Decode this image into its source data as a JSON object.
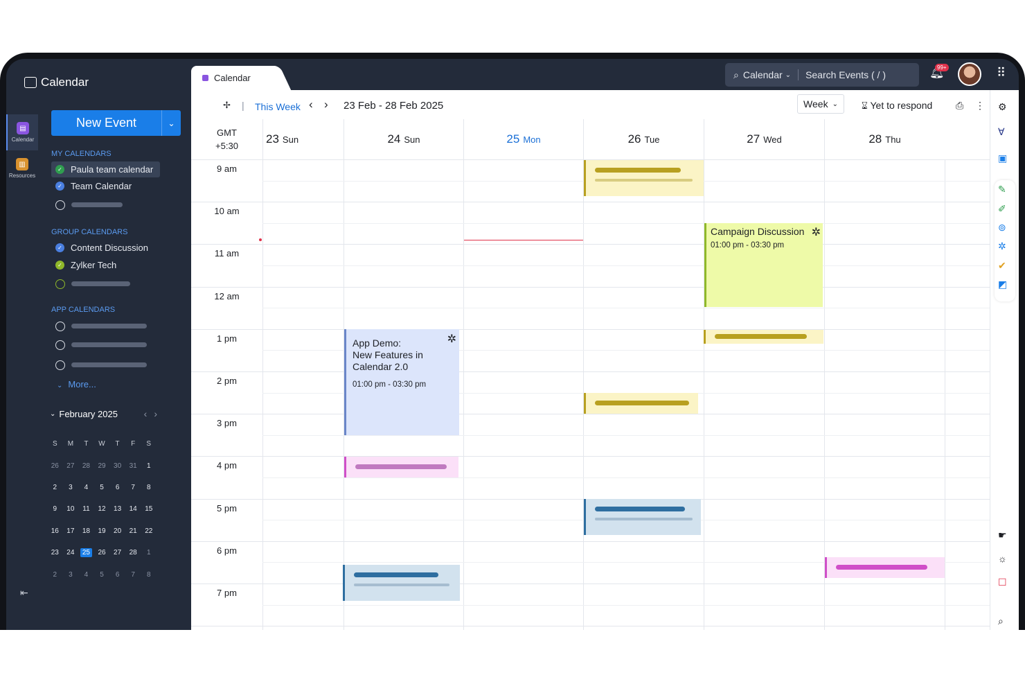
{
  "app": {
    "title": "Calendar",
    "tab_label": "Calendar"
  },
  "rail": [
    {
      "label": "Calendar",
      "color": "#8a55e0",
      "active": true
    },
    {
      "label": "Resources",
      "color": "#d9922e",
      "active": false
    }
  ],
  "sidebar": {
    "new_event_label": "New Event",
    "my_calendars_title": "MY CALENDARS",
    "my_calendars": [
      {
        "name": "Paula team calendar",
        "color": "#2f9e4f",
        "checked": true
      },
      {
        "name": "Team Calendar",
        "color": "#4a7fe0",
        "checked": true
      },
      {
        "name": "",
        "color": "#d8dce3",
        "checked": false
      }
    ],
    "group_calendars_title": "GROUP CALENDARS",
    "group_calendars": [
      {
        "name": "Content Discussion",
        "color": "#4a7fe0",
        "checked": true
      },
      {
        "name": "Zylker Tech",
        "color": "#8fb82a",
        "checked": true
      },
      {
        "name": "",
        "color": "#8fb82a",
        "checked": false
      }
    ],
    "app_calendars_title": "APP CALENDARS",
    "more_label": "More...",
    "mini_month": "February 2025",
    "mini_weekdays": [
      "S",
      "M",
      "T",
      "W",
      "T",
      "F",
      "S"
    ],
    "mini_weeks": [
      [
        "26",
        "27",
        "28",
        "29",
        "30",
        "31",
        "1"
      ],
      [
        "2",
        "3",
        "4",
        "5",
        "6",
        "7",
        "8"
      ],
      [
        "9",
        "10",
        "11",
        "12",
        "13",
        "14",
        "15"
      ],
      [
        "16",
        "17",
        "18",
        "19",
        "20",
        "21",
        "22"
      ],
      [
        "23",
        "24",
        "25",
        "26",
        "27",
        "28",
        "1"
      ],
      [
        "2",
        "3",
        "4",
        "5",
        "6",
        "7",
        "8"
      ]
    ]
  },
  "header": {
    "search_scope": "Calendar",
    "search_placeholder": "Search Events ( / )",
    "notif_badge": "99+"
  },
  "toolbar": {
    "this_week": "This Week",
    "date_range": "23 Feb - 28 Feb 2025",
    "view": "Week",
    "filter": "Yet to respond"
  },
  "grid": {
    "gmt_line1": "GMT",
    "gmt_line2": "+5:30",
    "days": [
      {
        "num": "23",
        "name": "Sun",
        "today": false
      },
      {
        "num": "24",
        "name": "Sun",
        "today": false
      },
      {
        "num": "25",
        "name": "Mon",
        "today": true
      },
      {
        "num": "26",
        "name": "Tue",
        "today": false
      },
      {
        "num": "27",
        "name": "Wed",
        "today": false
      },
      {
        "num": "28",
        "name": "Thu",
        "today": false
      }
    ],
    "hours": [
      "9 am",
      "10 am",
      "11 am",
      "12 am",
      "1 pm",
      "2 pm",
      "3 pm",
      "4 pm",
      "5 pm",
      "6 pm",
      "7 pm"
    ]
  },
  "events": {
    "campaign": {
      "title": "Campaign Discussion",
      "time": "01:00 pm - 03:30 pm"
    },
    "demo": {
      "title_l1": "App Demo:",
      "title_l2": "New Features in",
      "title_l3": "Calendar 2.0",
      "time": "01:00 pm - 03:30 pm"
    }
  }
}
